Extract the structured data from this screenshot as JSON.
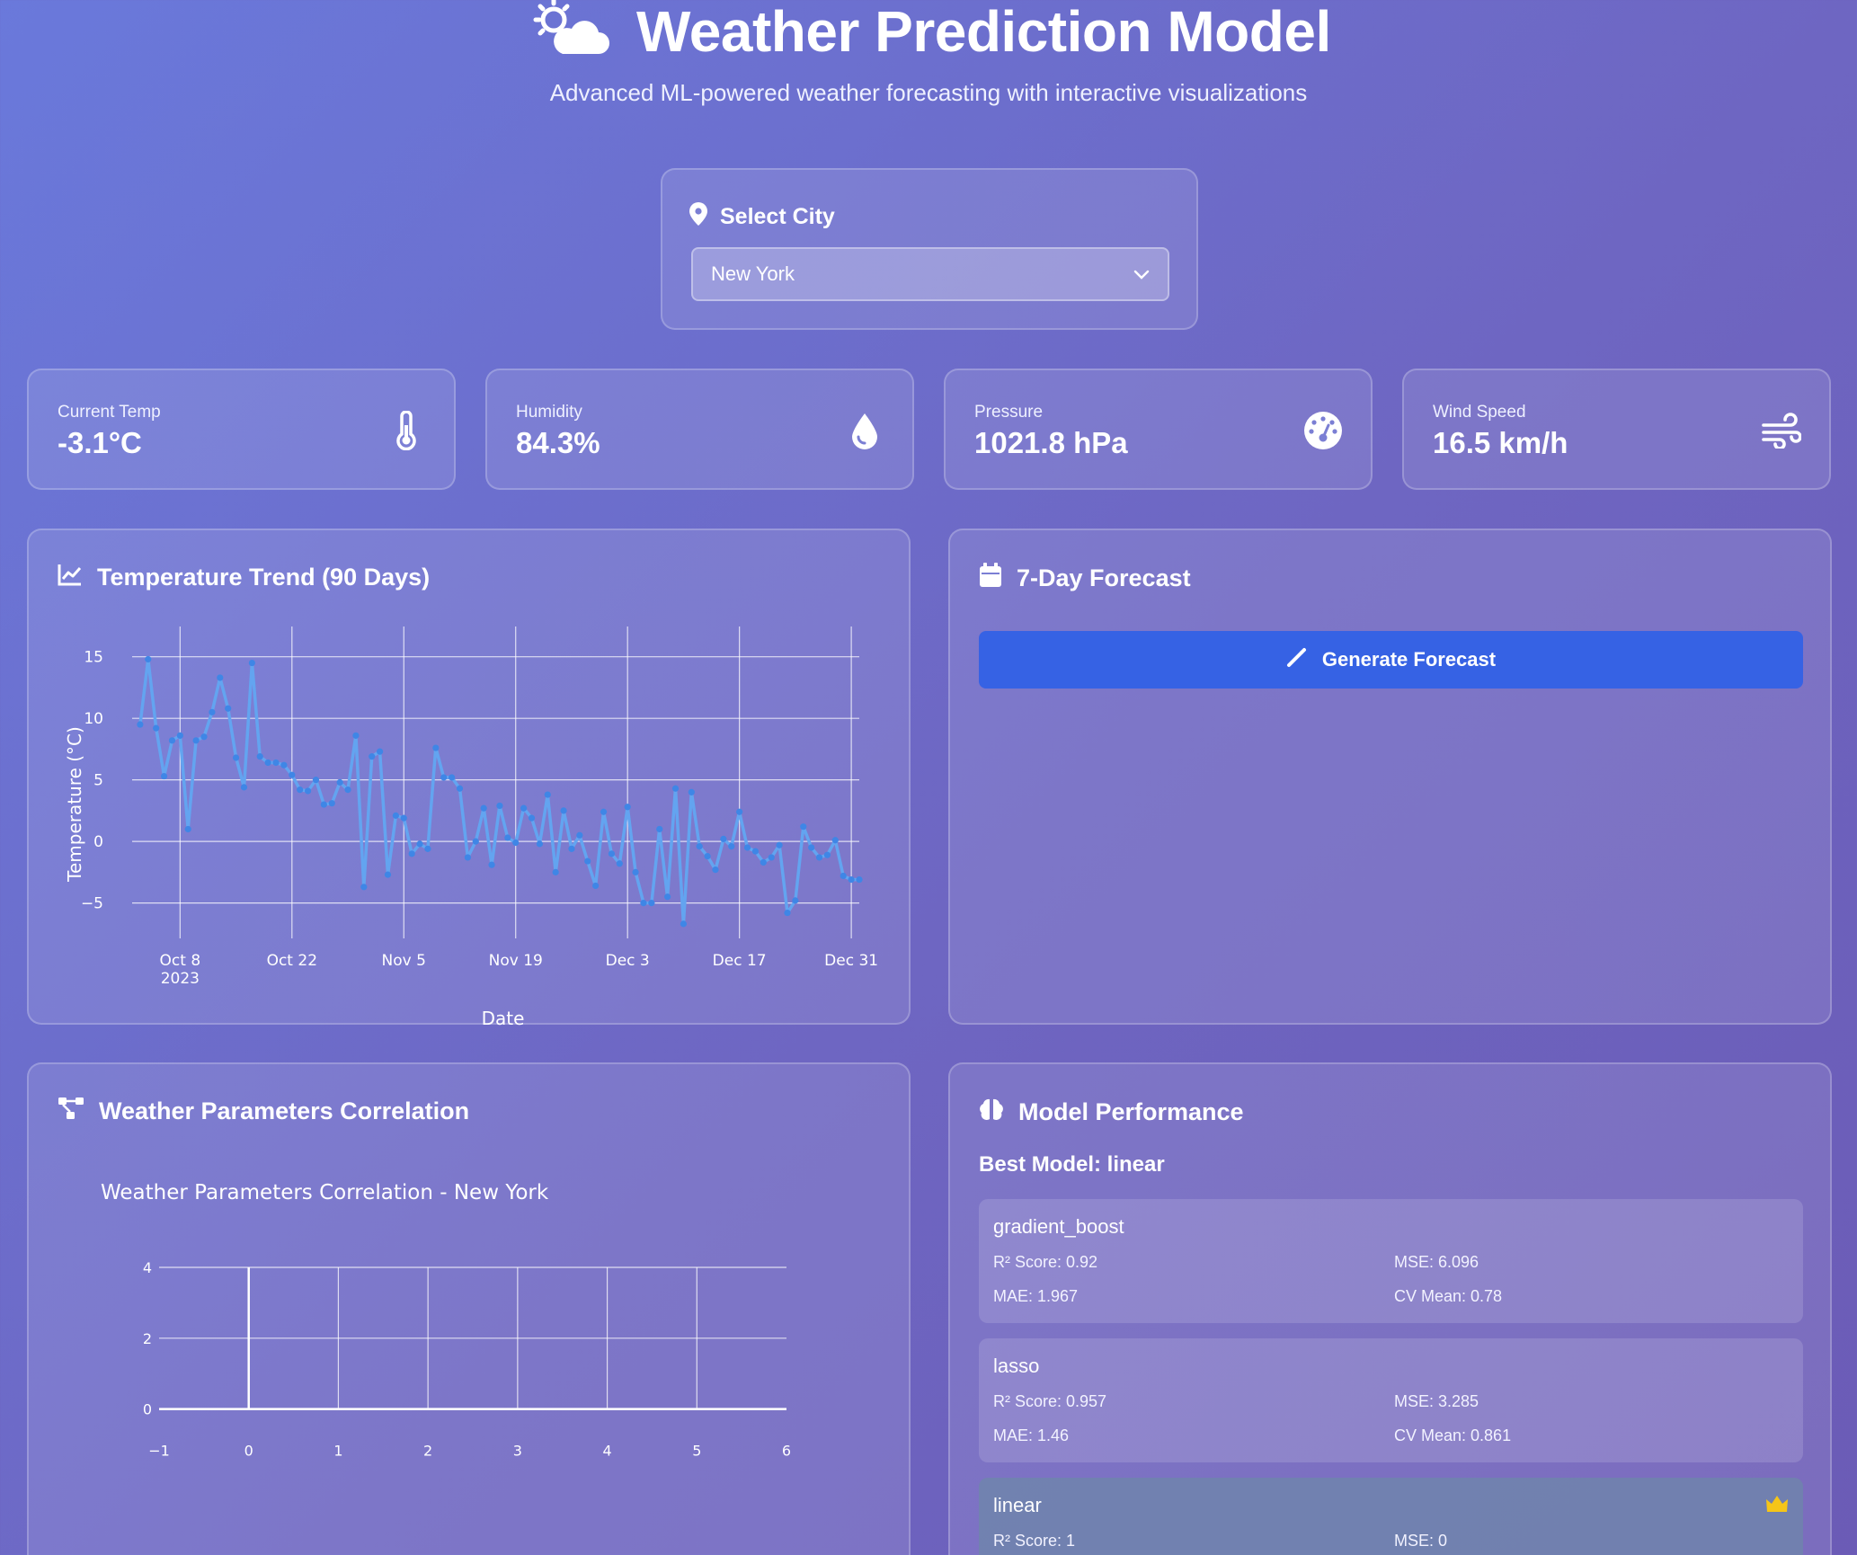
{
  "header": {
    "title": "Weather Prediction Model",
    "subtitle": "Advanced ML-powered weather forecasting with interactive visualizations"
  },
  "city": {
    "label": "Select City",
    "selected": "New York"
  },
  "stats": [
    {
      "label": "Current Temp",
      "value": "-3.1°C",
      "icon": "thermometer-icon"
    },
    {
      "label": "Humidity",
      "value": "84.3%",
      "icon": "droplet-icon"
    },
    {
      "label": "Pressure",
      "value": "1021.8 hPa",
      "icon": "gauge-icon"
    },
    {
      "label": "Wind Speed",
      "value": "16.5 km/h",
      "icon": "wind-icon"
    }
  ],
  "trend": {
    "title": "Temperature Trend (90 Days)",
    "icon": "chart-line-icon"
  },
  "forecast": {
    "title": "7-Day Forecast",
    "icon": "calendar-icon",
    "button_label": "Generate Forecast",
    "button_icon": "magic-wand-icon"
  },
  "correlation": {
    "title": "Weather Parameters Correlation",
    "icon": "network-icon"
  },
  "performance": {
    "title": "Model Performance",
    "icon": "brain-icon",
    "best_label": "Best Model: linear",
    "models": [
      {
        "name": "gradient_boost",
        "r2": "R² Score: 0.92",
        "mse": "MSE: 6.096",
        "mae": "MAE: 1.967",
        "cv": "CV Mean: 0.78",
        "best": false
      },
      {
        "name": "lasso",
        "r2": "R² Score: 0.957",
        "mse": "MSE: 3.285",
        "mae": "MAE: 1.46",
        "cv": "CV Mean: 0.861",
        "best": false
      },
      {
        "name": "linear",
        "r2": "R² Score: 1",
        "mse": "MSE: 0",
        "mae": "",
        "cv": "",
        "best": true
      }
    ]
  },
  "colors": {
    "accent": "#3662e4",
    "line": "#63a4f0",
    "crown": "#f5c518"
  },
  "chart_data": [
    {
      "type": "line",
      "title": "",
      "xlabel": "Date",
      "ylabel": "Temperature (°C)",
      "x_ticks": [
        "Oct 8\n2023",
        "Oct 22",
        "Nov 5",
        "Nov 19",
        "Dec 3",
        "Dec 17",
        "Dec 31"
      ],
      "y_ticks": [
        -5,
        0,
        5,
        10,
        15
      ],
      "ylim": [
        -7,
        16
      ],
      "xlim": [
        "2023-10-02",
        "2024-01-01"
      ],
      "grid": true,
      "x": [
        "2023-10-03",
        "2023-10-04",
        "2023-10-05",
        "2023-10-06",
        "2023-10-07",
        "2023-10-08",
        "2023-10-09",
        "2023-10-10",
        "2023-10-11",
        "2023-10-12",
        "2023-10-13",
        "2023-10-14",
        "2023-10-15",
        "2023-10-16",
        "2023-10-17",
        "2023-10-18",
        "2023-10-19",
        "2023-10-20",
        "2023-10-21",
        "2023-10-22",
        "2023-10-23",
        "2023-10-24",
        "2023-10-25",
        "2023-10-26",
        "2023-10-27",
        "2023-10-28",
        "2023-10-29",
        "2023-10-30",
        "2023-10-31",
        "2023-11-01",
        "2023-11-02",
        "2023-11-03",
        "2023-11-04",
        "2023-11-05",
        "2023-11-06",
        "2023-11-07",
        "2023-11-08",
        "2023-11-09",
        "2023-11-10",
        "2023-11-11",
        "2023-11-12",
        "2023-11-13",
        "2023-11-14",
        "2023-11-15",
        "2023-11-16",
        "2023-11-17",
        "2023-11-18",
        "2023-11-19",
        "2023-11-20",
        "2023-11-21",
        "2023-11-22",
        "2023-11-23",
        "2023-11-24",
        "2023-11-25",
        "2023-11-26",
        "2023-11-27",
        "2023-11-28",
        "2023-11-29",
        "2023-11-30",
        "2023-12-01",
        "2023-12-02",
        "2023-12-03",
        "2023-12-04",
        "2023-12-05",
        "2023-12-06",
        "2023-12-07",
        "2023-12-08",
        "2023-12-09",
        "2023-12-10",
        "2023-12-11",
        "2023-12-12",
        "2023-12-13",
        "2023-12-14",
        "2023-12-15",
        "2023-12-16",
        "2023-12-17",
        "2023-12-18",
        "2023-12-19",
        "2023-12-20",
        "2023-12-21",
        "2023-12-22",
        "2023-12-23",
        "2023-12-24",
        "2023-12-25",
        "2023-12-26",
        "2023-12-27",
        "2023-12-28",
        "2023-12-29",
        "2023-12-30",
        "2023-12-31",
        "2024-01-01"
      ],
      "y": [
        9.5,
        14.8,
        9.2,
        5.3,
        8.2,
        8.6,
        1.0,
        8.2,
        8.5,
        10.5,
        13.3,
        10.8,
        6.8,
        4.4,
        14.5,
        6.9,
        6.4,
        6.4,
        6.2,
        5.4,
        4.2,
        4.1,
        5.0,
        3.0,
        3.1,
        4.8,
        4.2,
        8.6,
        -3.7,
        6.9,
        7.3,
        -2.7,
        2.1,
        1.9,
        -1.0,
        -0.2,
        -0.6,
        7.6,
        5.2,
        5.2,
        4.3,
        -1.3,
        0.0,
        2.7,
        -1.9,
        2.9,
        0.3,
        -0.1,
        2.7,
        1.9,
        -0.2,
        3.8,
        -2.5,
        2.5,
        -0.6,
        0.5,
        -1.6,
        -3.6,
        2.4,
        -1.0,
        -1.8,
        2.8,
        -2.5,
        -5.0,
        -5.0,
        1.0,
        -4.5,
        4.3,
        -6.7,
        4.0,
        -0.4,
        -1.2,
        -2.3,
        0.2,
        -0.4,
        2.4,
        -0.5,
        -0.8,
        -1.7,
        -1.3,
        -0.3,
        -5.8,
        -4.8,
        1.2,
        -0.5,
        -1.3,
        -1.1,
        0.1,
        -2.8,
        -3.1,
        -3.1
      ],
      "series": [
        {
          "name": "Temperature",
          "color": "#63a4f0"
        }
      ]
    },
    {
      "type": "scatter",
      "title": "Weather Parameters Correlation - New York",
      "xlabel": "",
      "ylabel": "",
      "x_ticks": [
        -1,
        0,
        1,
        2,
        3,
        4,
        5,
        6
      ],
      "y_ticks": [
        0,
        2,
        4
      ],
      "xlim": [
        -1,
        6
      ],
      "ylim": [
        -1,
        4
      ],
      "grid": true,
      "series": []
    }
  ]
}
